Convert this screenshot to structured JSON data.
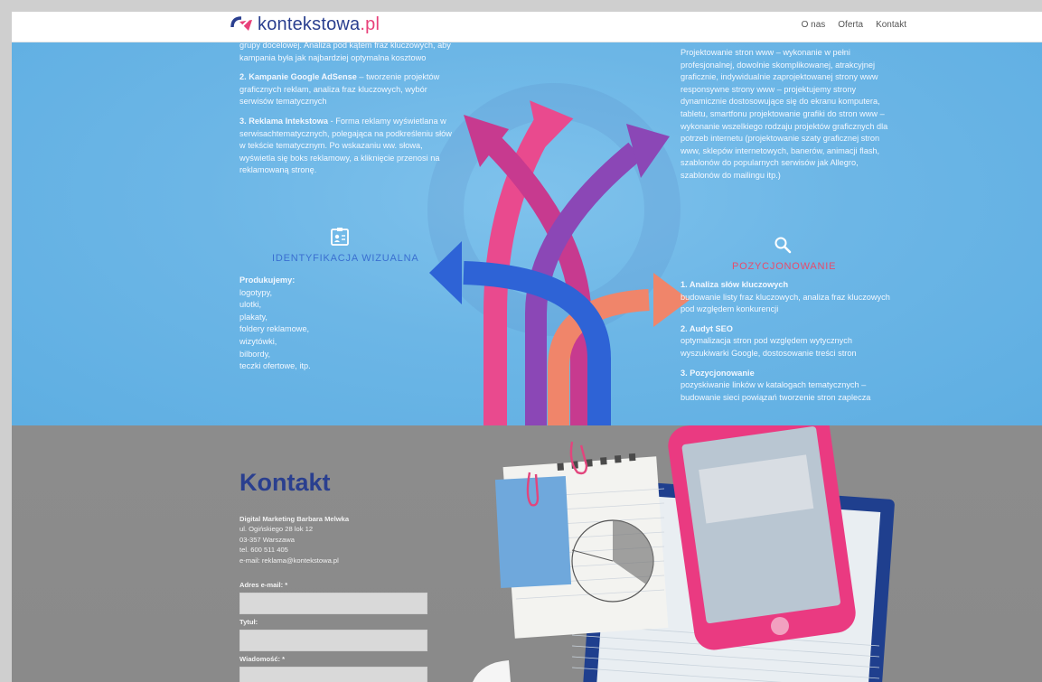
{
  "header": {
    "logo_main": "kontekstowa",
    "logo_tld": ".pl",
    "nav": [
      "O nas",
      "Oferta",
      "Kontakt"
    ]
  },
  "left_column": {
    "p1": "grupy docelowej. Analiza pod kątem fraz kluczowych, aby kampania była jak najbardziej optymalna kosztowo",
    "p2_title": "2. Kampanie Google AdSense",
    "p2_text": " – tworzenie projektów graficznych reklam, analiza fraz kluczowych, wybór serwisów tematycznych",
    "p3_title": "3. Reklama Intekstowa",
    "p3_text": " - Forma reklamy wyświetlana w serwisachtematycznych, polegająca na podkreśleniu słów w tekście tematycznym. Po wskazaniu ww. słowa, wyświetla się boks reklamowy, a kliknięcie przenosi na reklamowaną stronę."
  },
  "identyfikacja": {
    "title": "IDENTYFIKACJA WIZUALNA",
    "intro": "Produkujemy:",
    "items": [
      "logotypy,",
      "ulotki,",
      "plakaty,",
      "foldery reklamowe,",
      "wizytówki,",
      "bilbordy,",
      "teczki ofertowe, itp."
    ]
  },
  "right_column": {
    "text": "Projektowanie stron www – wykonanie w pełni profesjonalnej, dowolnie skomplikowanej, atrakcyjnej graficznie, indywidualnie zaprojektowanej strony www responsywne strony www – projektujemy strony dynamicznie dostosowujące się do ekranu komputera, tabletu, smartfonu projektowanie grafiki do stron www – wykonanie wszelkiego rodzaju projektów graficznych dla potrzeb internetu (projektowanie szaty graficznej stron www, sklepów internetowych, banerów, animacji flash, szablonów do popularnych serwisów jak Allegro, szablonów do mailingu itp.)"
  },
  "pozycjonowanie": {
    "title": "POZYCJONOWANIE",
    "items": [
      {
        "title": "1. Analiza słów kluczowych",
        "text": "budowanie listy fraz kluczowych, analiza fraz kluczowych pod względem konkurencji"
      },
      {
        "title": "2. Audyt SEO",
        "text": "optymalizacja stron pod względem wytycznych wyszukiwarki Google, dostosowanie treści stron"
      },
      {
        "title": "3. Pozycjonowanie",
        "text": "pozyskiwanie linków w katalogach tematycznych – budowanie sieci powiązań tworzenie stron zaplecza"
      }
    ]
  },
  "kontakt": {
    "title": "Kontakt",
    "company": "Digital Marketing Barbara Melwka",
    "street": "ul. Ogińskiego 28 lok 12",
    "city": "03-357 Warszawa",
    "phone": "tel. 600 511 405",
    "email": "e-mail: reklama@kontekstowa.pl",
    "form": {
      "email_label": "Adres e-mail: *",
      "title_label": "Tytuł:",
      "message_label": "Wiadomość: *"
    }
  },
  "colors": {
    "brand_blue": "#2a3f8f",
    "brand_pink": "#e8417a",
    "section_blue": "#6cb6e6",
    "section_gray": "#8c8c8c"
  }
}
